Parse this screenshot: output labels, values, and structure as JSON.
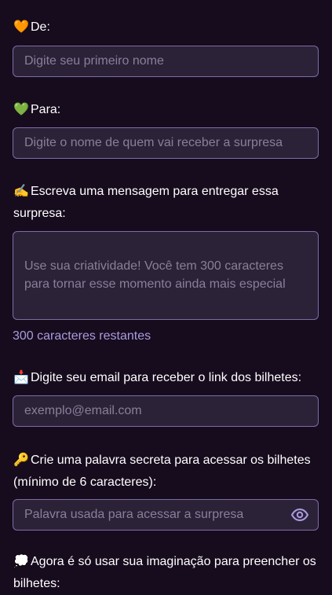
{
  "form": {
    "from": {
      "icon": "orange-heart-icon",
      "emoji": "🧡",
      "label": "De:",
      "placeholder": "Digite seu primeiro nome"
    },
    "to": {
      "icon": "green-heart-icon",
      "emoji": "💚",
      "label": "Para:",
      "placeholder": "Digite o nome de quem vai receber a surpresa"
    },
    "message": {
      "icon": "writing-hand-icon",
      "emoji": "✍️",
      "label": "Escreva uma mensagem para entregar essa surpresa:",
      "placeholder": "Use sua criatividade! Você tem 300 caracteres para tornar esse momento ainda mais especial",
      "counter": "300 caracteres restantes"
    },
    "email": {
      "icon": "envelope-icon",
      "emoji": "📩",
      "label": "Digite seu email para receber o link dos bilhetes:",
      "placeholder": "exemplo@email.com"
    },
    "password": {
      "icon": "key-icon",
      "emoji": "🔑",
      "label": "Crie uma palavra secreta para acessar os bilhetes (mínimo de 6 caracteres):",
      "placeholder": "Palavra usada para acessar a surpresa",
      "toggle_icon": "eye-icon"
    },
    "notes": {
      "icon": "speech-bubble-icon",
      "emoji": "💭",
      "label": "Agora é só usar sua imaginação para preencher os bilhetes:"
    }
  },
  "colors": {
    "background": "#170c1d",
    "field_background": "#2c2238",
    "field_border": "#7c6ca8",
    "placeholder_text": "#8a7f98",
    "counter_text": "#a99be0",
    "label_text": "#ffffff"
  }
}
